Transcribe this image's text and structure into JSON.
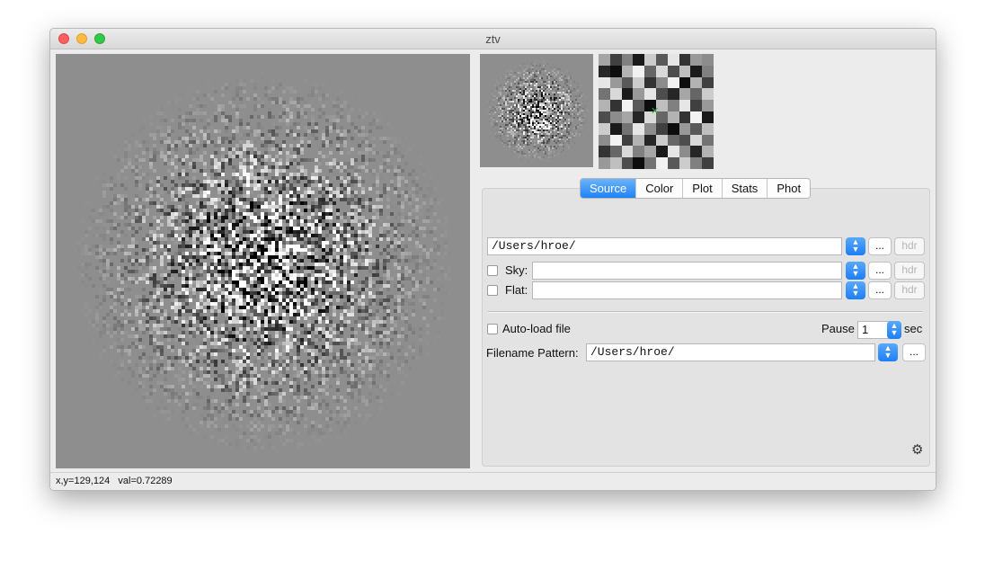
{
  "window": {
    "title": "ztv"
  },
  "tabs": [
    "Source",
    "Color",
    "Plot",
    "Stats",
    "Phot"
  ],
  "active_tab": "Source",
  "source": {
    "path_value": "/Users/hroe/",
    "sky_label": "Sky:",
    "sky_value": "",
    "flat_label": "Flat:",
    "flat_value": "",
    "browse_label": "...",
    "hdr_label": "hdr",
    "autoload_label": "Auto-load file",
    "pause_label": "Pause",
    "pause_value": "1",
    "pause_unit": "sec",
    "pattern_label": "Filename Pattern:",
    "pattern_value": "/Users/hroe/"
  },
  "status": {
    "coords": "x,y=129,124",
    "value": "val=0.72289"
  },
  "zoom_grid": [
    [
      0.65,
      0.25,
      0.5,
      0.1,
      0.8,
      0.35,
      0.9,
      0.2,
      0.6,
      0.55
    ],
    [
      0.15,
      0.05,
      0.7,
      0.95,
      0.4,
      0.85,
      0.3,
      0.75,
      0.1,
      0.5
    ],
    [
      0.9,
      0.6,
      0.35,
      0.8,
      0.2,
      0.55,
      0.95,
      0.05,
      0.7,
      0.25
    ],
    [
      0.45,
      0.85,
      0.1,
      0.6,
      0.9,
      0.3,
      0.15,
      0.65,
      0.4,
      0.8
    ],
    [
      0.7,
      0.2,
      0.95,
      0.35,
      0.05,
      0.75,
      0.5,
      0.9,
      0.25,
      0.6
    ],
    [
      0.3,
      0.55,
      0.65,
      0.15,
      0.85,
      0.4,
      0.7,
      0.2,
      0.95,
      0.1
    ],
    [
      0.8,
      0.1,
      0.45,
      0.9,
      0.55,
      0.25,
      0.05,
      0.6,
      0.35,
      0.75
    ],
    [
      0.55,
      0.95,
      0.25,
      0.7,
      0.15,
      0.8,
      0.4,
      0.3,
      0.85,
      0.45
    ],
    [
      0.2,
      0.4,
      0.85,
      0.5,
      0.65,
      0.1,
      0.9,
      0.55,
      0.15,
      0.7
    ],
    [
      0.6,
      0.75,
      0.3,
      0.05,
      0.45,
      0.95,
      0.35,
      0.8,
      0.5,
      0.25
    ]
  ]
}
